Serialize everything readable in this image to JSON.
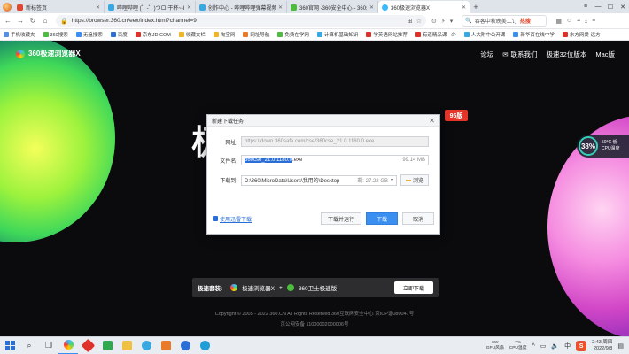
{
  "tabs": [
    {
      "title": "新标签页",
      "active": false,
      "color": "#e0472f"
    },
    {
      "title": "哔哩哔哩 (゜-゜)つロ 干杯~-bili",
      "active": false,
      "color": "#3aa8e0"
    },
    {
      "title": "创作中心 - 哔哩哔哩弹幕视频网",
      "active": false,
      "color": "#3aa8e0"
    },
    {
      "title": "360官网 -360安全中心 - 360杀毒",
      "active": false,
      "color": "#4cbb3e"
    },
    {
      "title": "360极速浏览器X",
      "active": true,
      "color": "#3bb8ff"
    }
  ],
  "toolbar": {
    "url": "https://browser.360.cn/eex/index.html?channel=9",
    "search_text": "吞客中秋晚美工订",
    "search_hot": "热搜"
  },
  "bookmarks": [
    {
      "label": "手机收藏夹",
      "color": "#5a8fe0"
    },
    {
      "label": "360搜索",
      "color": "#4cbb3e"
    },
    {
      "label": "无追搜索",
      "color": "#3a8ff0"
    },
    {
      "label": "百度",
      "color": "#2b6fd6"
    },
    {
      "label": "京东JD.COM",
      "color": "#e0302a"
    },
    {
      "label": "收藏夹栏",
      "color": "#f0b429"
    },
    {
      "label": "淘宝网",
      "color": "#f0b429"
    },
    {
      "label": "网址导航",
      "color": "#e87a2a"
    },
    {
      "label": "免费在学网",
      "color": "#4cbb3e"
    },
    {
      "label": "计算机基础知识",
      "color": "#3aa8e0"
    },
    {
      "label": "学英语网站推荐",
      "color": "#e0302a"
    },
    {
      "label": "有道精品课 - 少",
      "color": "#e0302a"
    },
    {
      "label": "人大附中公开课",
      "color": "#3aa8e0"
    },
    {
      "label": "新华百在线中学",
      "color": "#3a8ff0"
    },
    {
      "label": "东方网爱·远方",
      "color": "#e0302a"
    }
  ],
  "page": {
    "logo": "360极速浏览器X",
    "nav": [
      "论坛",
      "联系我们",
      "极速32位版本",
      "Mac版"
    ],
    "hero": "极",
    "badge": "95版",
    "cpu": {
      "percent": "38%",
      "temp": "50°C 低",
      "label": "CPU温度"
    },
    "install": {
      "label": "极速套装:",
      "items": [
        "极速浏览器X",
        "360卫士极速版"
      ],
      "plus": "+",
      "button": "立即下载"
    },
    "copyright": "Copyright © 2005 - 2022 360.CN All Rights Reserved 360互联网安全中心 京ICP证080047号",
    "icp": "京公网安备 11000002000006号"
  },
  "dialog": {
    "title": "新建下载任务",
    "url_label": "网址:",
    "url_value": "https://down.360safe.com/cse/360cse_21.0.1180.0.exe",
    "name_label": "文件名:",
    "name_selected": "360cse_21.0.1180.0",
    "name_ext": ".exe",
    "size": "99.14 MB",
    "dir_label": "下载到:",
    "dir_value": "D:\\360\\MicroData\\Users\\我用的\\Desktop",
    "space": "剩: 27.22 GB",
    "browse": "浏览",
    "link": "使用迅雷下载",
    "btn_open": "下载并运行",
    "btn_download": "下载",
    "btn_cancel": "取消"
  },
  "taskbar": {
    "stats": [
      {
        "value": "6W",
        "label": "GPU风扇"
      },
      {
        "value": "7%",
        "label": "CPU温度"
      }
    ],
    "ime": "中",
    "time": "2:43 周四",
    "date": "2022/9/8"
  }
}
